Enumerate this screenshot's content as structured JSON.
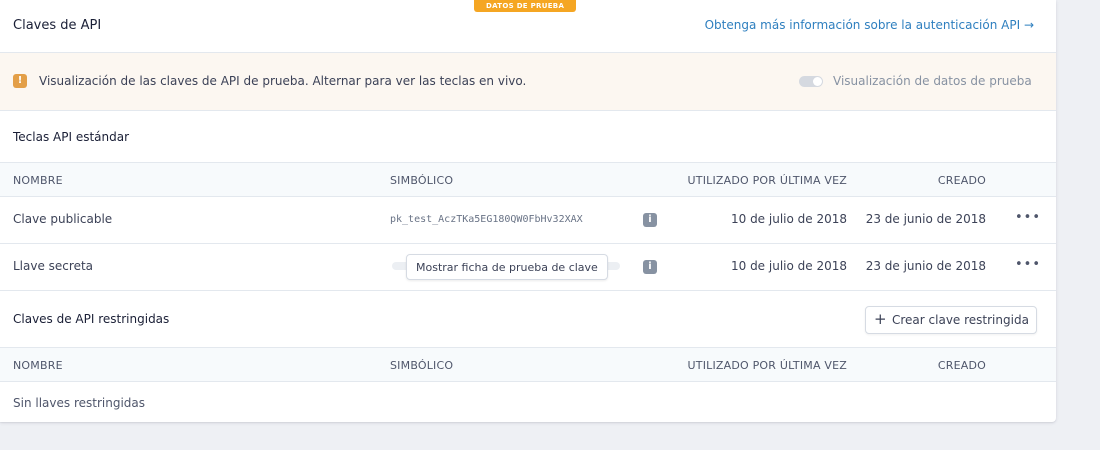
{
  "badge": "DATOS DE PRUEBA",
  "header": {
    "title": "Claves de API",
    "link": "Obtenga más información sobre la autenticación API →"
  },
  "notice": {
    "icon": "info-icon",
    "message": "Visualización de las claves de API de prueba. Alternar para ver las teclas en vivo.",
    "toggle_label": "Visualización de datos de prueba",
    "toggle_on": false
  },
  "standard": {
    "title": "Teclas API estándar",
    "columns": [
      "NOMBRE",
      "SIMBÓLICO",
      "UTILIZADO POR ÚLTIMA VEZ",
      "CREADO"
    ],
    "rows": [
      {
        "name": "Clave publicable",
        "token": "pk_test_AczTKa5EG180QW0FbHv32XAX",
        "last_used": "10 de julio de 2018",
        "created": "23 de junio de 2018"
      },
      {
        "name": "Llave secreta",
        "reveal_label": "Mostrar ficha de prueba de clave",
        "last_used": "10 de julio de 2018",
        "created": "23 de junio de 2018"
      }
    ]
  },
  "restricted": {
    "title": "Claves de API restringidas",
    "create_label": "Crear clave restringida",
    "columns": [
      "NOMBRE",
      "SIMBÓLICO",
      "UTILIZADO POR ÚLTIMA VEZ",
      "CREADO"
    ],
    "empty": "Sin llaves restringidas"
  },
  "colors": {
    "accent": "#2e7fbf",
    "badge": "#f5a623",
    "notice_bg": "#fcf7f1"
  }
}
